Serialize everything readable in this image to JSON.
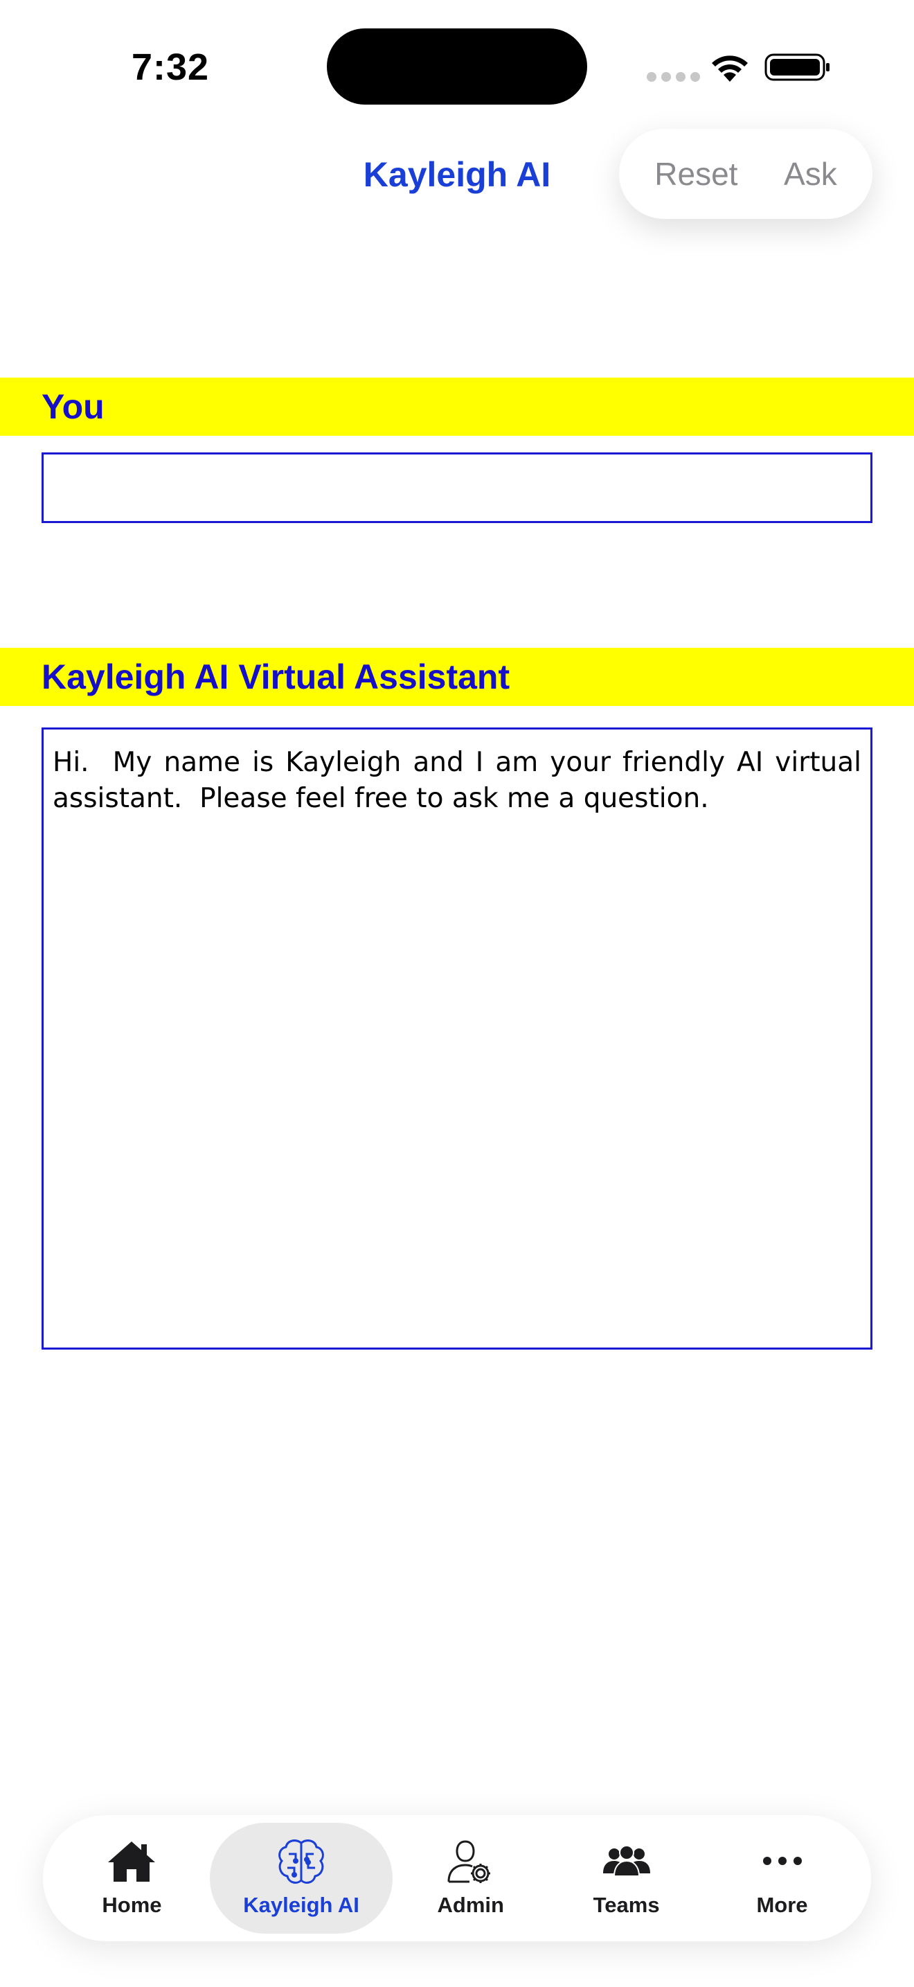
{
  "status_bar": {
    "time": "7:32"
  },
  "nav": {
    "title": "Kayleigh AI",
    "reset_label": "Reset",
    "ask_label": "Ask"
  },
  "you_section": {
    "header": "You",
    "input_value": ""
  },
  "assistant_section": {
    "header": "Kayleigh AI Virtual Assistant",
    "response": "Hi.  My name is Kayleigh and I am your friendly AI virtual assistant.  Please feel free to ask me a question."
  },
  "tab_bar": {
    "tabs": [
      {
        "label": "Home",
        "icon": "house-icon",
        "active": false
      },
      {
        "label": "Kayleigh AI",
        "icon": "brain-circuit-icon",
        "active": true
      },
      {
        "label": "Admin",
        "icon": "person-gear-icon",
        "active": false
      },
      {
        "label": "Teams",
        "icon": "people-group-icon",
        "active": false
      },
      {
        "label": "More",
        "icon": "ellipsis-icon",
        "active": false
      }
    ]
  },
  "colors": {
    "accent": "#1a3fd6",
    "section_header_bg": "#ffff00",
    "section_header_text": "#1510c8",
    "box_border": "#1a1ad4"
  }
}
